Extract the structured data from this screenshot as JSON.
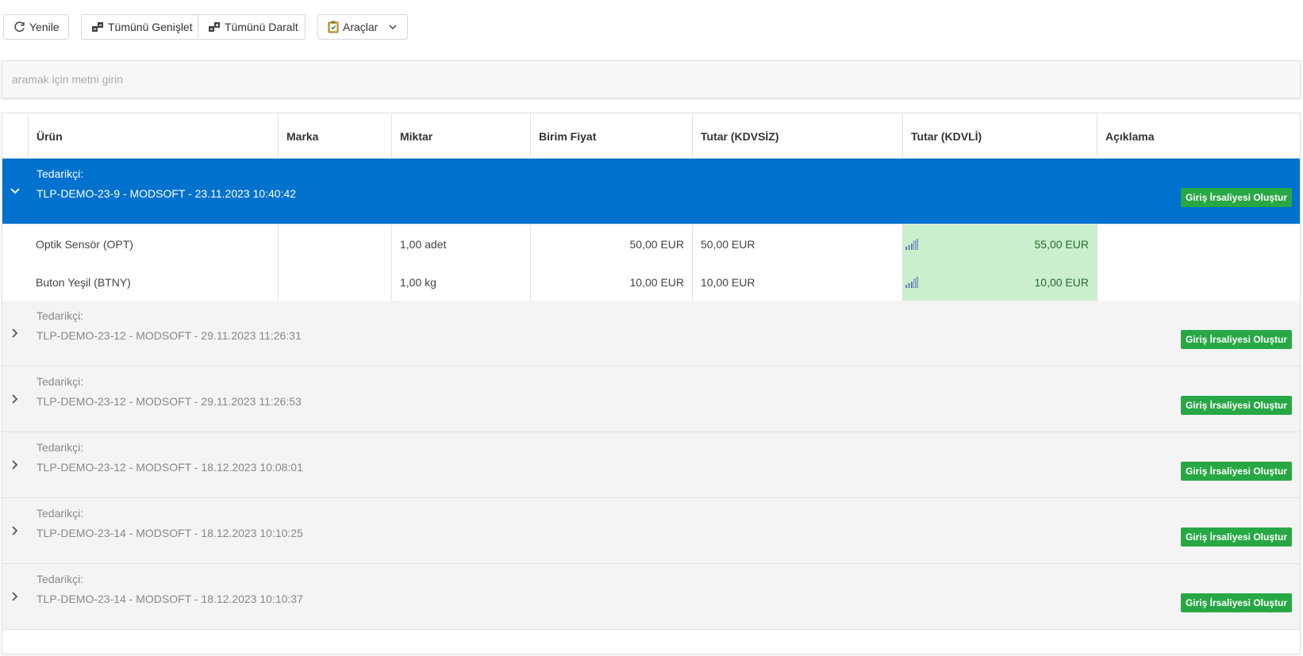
{
  "toolbar": {
    "refresh": "Yenile",
    "expand_all": "Tümünü Genişlet",
    "collapse_all": "Tümünü Daralt",
    "tools": "Araçlar"
  },
  "search": {
    "placeholder": "aramak için metni girin"
  },
  "columns": [
    "Ürün",
    "Marka",
    "Miktar",
    "Birim Fiyat",
    "Tutar (KDVSİZ)",
    "Tutar (KDVLİ)",
    "Açıklama"
  ],
  "group_label": "Tedarikçi:",
  "group_button": "Giriş İrsaliyesi Oluştur",
  "groups": [
    {
      "title": "TLP-DEMO-23-9 - MODSOFT - 23.11.2023 10:40:42",
      "expanded": true,
      "rows": [
        {
          "product": "Optik Sensör (OPT)",
          "brand": "",
          "qty": "1,00 adet",
          "unit_price": "50,00 EUR",
          "net": "50,00 EUR",
          "gross": "55,00 EUR",
          "note": ""
        },
        {
          "product": "Buton Yeşil (BTNY)",
          "brand": "",
          "qty": "1,00 kg",
          "unit_price": "10,00 EUR",
          "net": "10,00 EUR",
          "gross": "10,00 EUR",
          "note": ""
        }
      ]
    },
    {
      "title": "TLP-DEMO-23-12 - MODSOFT - 29.11.2023 11:26:31",
      "expanded": false
    },
    {
      "title": "TLP-DEMO-23-12 - MODSOFT - 29.11.2023 11:26:53",
      "expanded": false
    },
    {
      "title": "TLP-DEMO-23-12 - MODSOFT - 18.12.2023 10:08:01",
      "expanded": false
    },
    {
      "title": "TLP-DEMO-23-14 - MODSOFT - 18.12.2023 10:10:25",
      "expanded": false
    },
    {
      "title": "TLP-DEMO-23-14 - MODSOFT - 18.12.2023 10:10:37",
      "expanded": false
    }
  ],
  "colors": {
    "selected_group_bg": "#0071cd",
    "action_button": "#28a745",
    "highlight_cell": "#c9efcc"
  },
  "icons": {
    "refresh": "refresh-icon",
    "expand": "expand-all-icon",
    "collapse": "collapse-all-icon",
    "tools": "clipboard-icon",
    "chevron": "chevron-down-icon",
    "bars": "signal-bars-icon"
  }
}
